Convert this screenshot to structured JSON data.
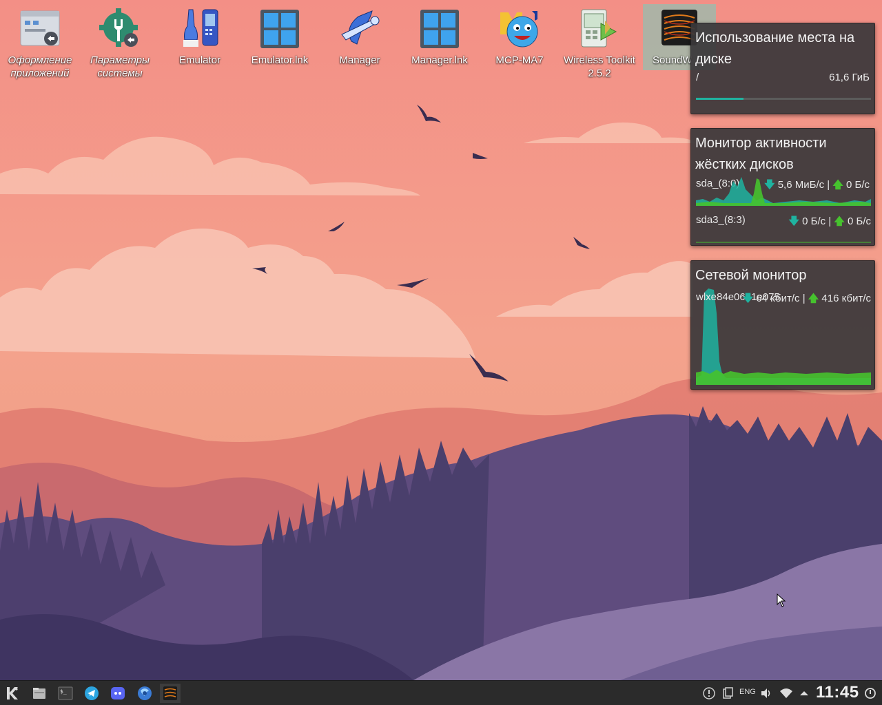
{
  "desktop": {
    "icons": [
      {
        "label": "Оформление приложений",
        "icon": "appearance-settings-icon",
        "italic": true
      },
      {
        "label": "Параметры системы",
        "icon": "system-settings-icon",
        "italic": true
      },
      {
        "label": "Emulator",
        "icon": "emulator-icon",
        "italic": false
      },
      {
        "label": "Emulator.lnk",
        "icon": "windows-shortcut-icon",
        "italic": false
      },
      {
        "label": "Manager",
        "icon": "manager-icon",
        "italic": false
      },
      {
        "label": "Manager.lnk",
        "icon": "windows-shortcut-icon",
        "italic": false
      },
      {
        "label": "MCP-MA7",
        "icon": "mcp-ma7-icon",
        "italic": false
      },
      {
        "label": "Wireless Toolkit 2.5.2",
        "icon": "wireless-toolkit-icon",
        "italic": false
      },
      {
        "label": "SoundW",
        "icon": "soundwire-icon",
        "italic": false,
        "selected": true
      }
    ]
  },
  "widgets": {
    "disk_usage": {
      "title": "Использование места на диске",
      "mount": "/",
      "size": "61,6 ГиБ",
      "used_fraction": 0.27,
      "bar_color": "#1fb3a0"
    },
    "disk_activity": {
      "title": "Монитор активности жёстких дисков",
      "devices": [
        {
          "name": "sda_(8:0)",
          "read": "5,6 МиБ/с",
          "separator": "|",
          "write": "0 Б/с"
        },
        {
          "name": "sda3_(8:3)",
          "read": "0 Б/с",
          "separator": "|",
          "write": "0 Б/с"
        }
      ]
    },
    "network": {
      "title": "Сетевой монитор",
      "interface": "wlxe84e0681e075",
      "down": "64 кбит/с",
      "separator": "|",
      "up": "416 кбит/с"
    }
  },
  "taskbar": {
    "launcher": "kde-launcher-icon",
    "apps": [
      "file-manager-icon",
      "terminal-icon",
      "telegram-icon",
      "discord-icon",
      "browser-icon",
      "soundwire-icon"
    ],
    "tray": [
      "updates-icon",
      "clipboard-icon",
      "volume-icon",
      "wifi-icon",
      "expand-tray-icon",
      "power-icon"
    ],
    "language": "ENG",
    "clock": "11:45"
  },
  "colors": {
    "download": "#1fb3a0",
    "upload": "#46c22e",
    "widget_bg": "#3a383a"
  }
}
